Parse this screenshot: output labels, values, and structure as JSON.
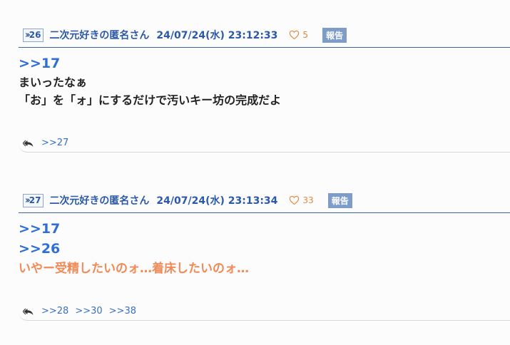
{
  "posts": [
    {
      "number": "26",
      "author": "二次元好きの匿名さん",
      "date": "24/07/24(水) 23:12:33",
      "likes": "5",
      "report_label": "報告",
      "anchors": [
        ">>17"
      ],
      "lines": [
        "まいったなぁ",
        "「お」を「ォ」にするだけで汚いキー坊の完成だよ"
      ],
      "replies": [
        ">>27"
      ]
    },
    {
      "number": "27",
      "author": "二次元好きの匿名さん",
      "date": "24/07/24(水) 23:13:34",
      "likes": "33",
      "report_label": "報告",
      "anchors": [
        ">>17",
        ">>26"
      ],
      "lines": [
        "いやー受精したいのォ…着床したいのォ…"
      ],
      "replies": [
        ">>28",
        ">>30",
        ">>38"
      ]
    }
  ],
  "colors": {
    "accent_blue": "#2b59a8",
    "anchor_blue": "#2e6fd6",
    "like_orange": "#e0883e",
    "highlight_orange": "#f08a57",
    "report_bg": "#7d9cc8"
  },
  "icons": {
    "post_number": "double-chevron-right-icon",
    "like": "heart-outline-icon",
    "reply": "reply-arrows-icon"
  }
}
